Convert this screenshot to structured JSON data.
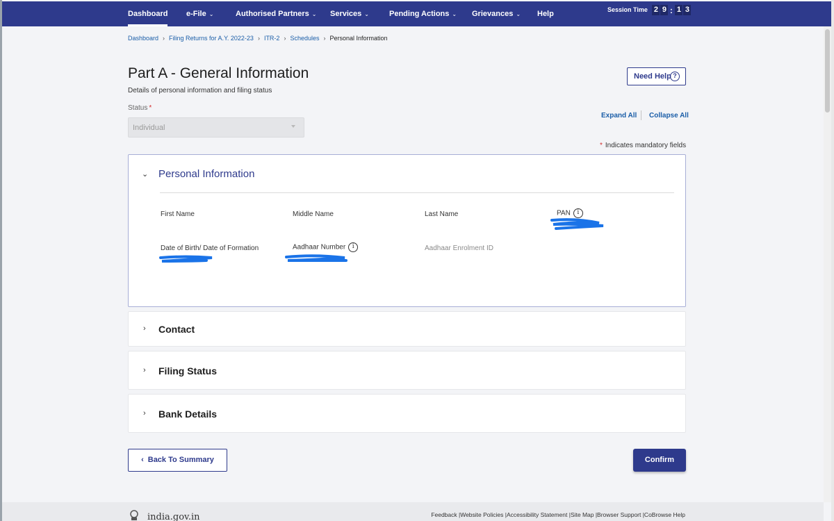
{
  "nav": {
    "items": [
      {
        "label": "Dashboard",
        "active": true
      },
      {
        "label": "e-File",
        "dropdown": true
      },
      {
        "label": "Authorised Partners",
        "dropdown": true
      },
      {
        "label": "Services",
        "dropdown": true
      },
      {
        "label": "Pending Actions",
        "dropdown": true
      },
      {
        "label": "Grievances",
        "dropdown": true
      },
      {
        "label": "Help"
      }
    ],
    "session_label": "Session Time",
    "session_digits": [
      "2",
      "9",
      "1",
      "3"
    ]
  },
  "breadcrumb": [
    "Dashboard",
    "Filing Returns for A.Y. 2022-23",
    "ITR-2",
    "Schedules",
    "Personal Information"
  ],
  "header": {
    "title": "Part A - General Information",
    "subtitle": "Details of personal information and filing status",
    "help_label": "Need Help",
    "help_icon": "?"
  },
  "status": {
    "label": "Status",
    "required_mark": "*",
    "value": "Individual"
  },
  "controls": {
    "expand_all": "Expand All",
    "collapse_all": "Collapse All",
    "mandatory_mark": "*",
    "mandatory_text": "Indicates mandatory fields"
  },
  "personal": {
    "title": "Personal Information",
    "fields": {
      "first_name": "First Name",
      "middle_name": "Middle Name",
      "last_name": "Last Name",
      "pan": "PAN",
      "dob": "Date of Birth/ Date of Formation",
      "aadhaar": "Aadhaar Number",
      "enrolment": "Aadhaar Enrolment ID"
    },
    "info_icon": "i"
  },
  "sections": [
    "Contact",
    "Filing Status",
    "Bank Details"
  ],
  "actions": {
    "back_chev": "‹",
    "back": "Back To Summary",
    "confirm": "Confirm"
  },
  "footer": {
    "site": "india.gov.in",
    "links": "Feedback |Website Policies |Accessibility Statement |Site Map |Browser Support |CoBrowse Help"
  },
  "colors": {
    "primary": "#2e3a8c",
    "link": "#1b5ea8",
    "redaction": "#1a73e8"
  }
}
